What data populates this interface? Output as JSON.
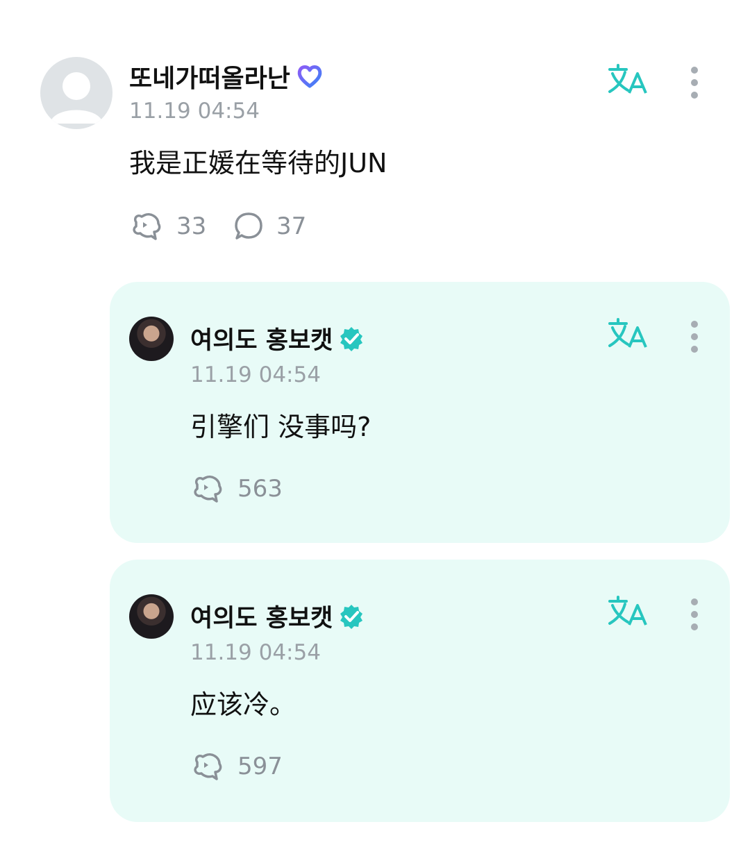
{
  "post": {
    "username": "또네가떠올라난",
    "timestamp": "11.19 04:54",
    "text": "我是正媛在等待的JUN",
    "likes": "33",
    "comments": "37",
    "badge_icon": "heart-icon",
    "badge_color": "#6c6cf0"
  },
  "replies": [
    {
      "username": "여의도 홍보캣",
      "timestamp": "11.19 04:54",
      "text": "引擎们 没事吗?",
      "likes": "563",
      "badge_icon": "verified-badge-icon"
    },
    {
      "username": "여의도 홍보캣",
      "timestamp": "11.19 04:54",
      "text": "应该冷。",
      "likes": "597",
      "badge_icon": "verified-badge-icon"
    }
  ],
  "colors": {
    "accent": "#27c6bf",
    "reply_bg": "#e8fbf7",
    "meta_gray": "#9aa0a6"
  }
}
